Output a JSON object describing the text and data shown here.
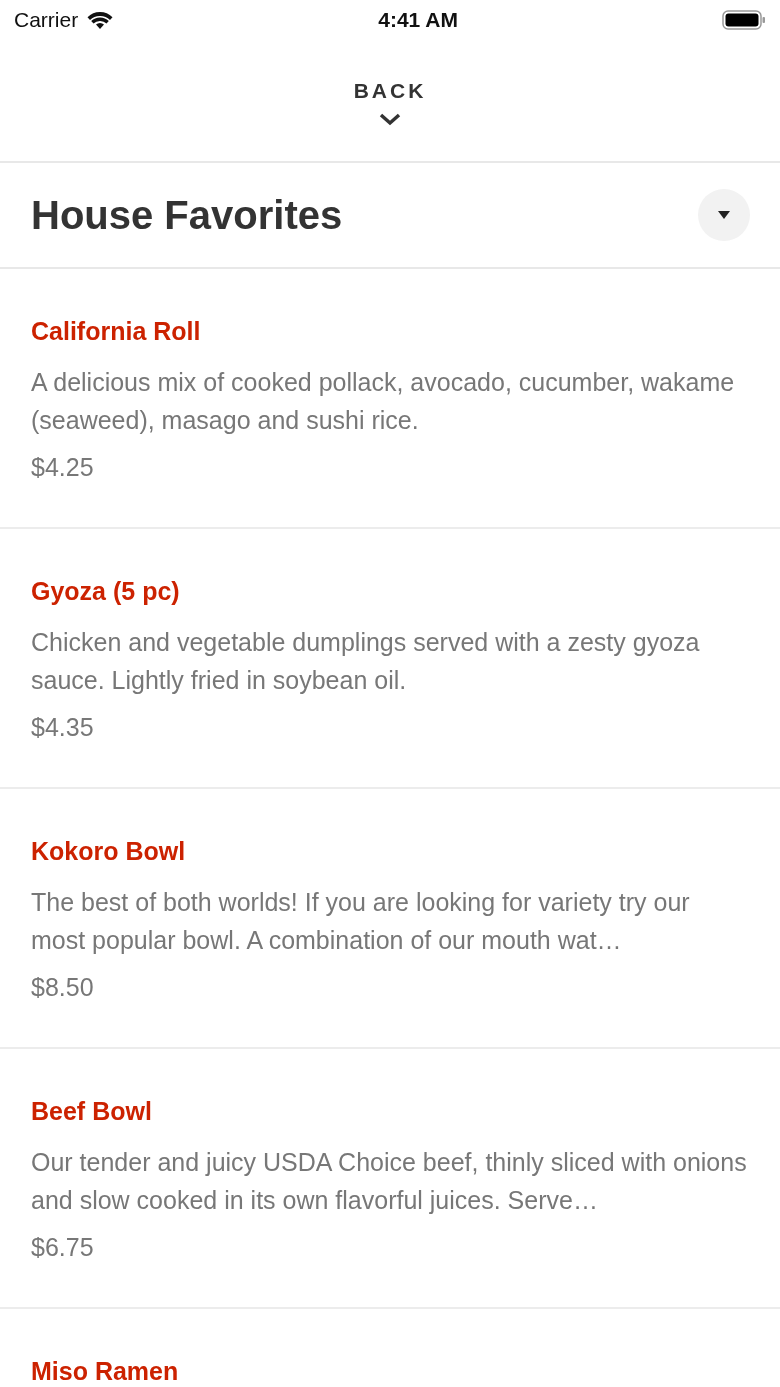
{
  "status_bar": {
    "carrier": "Carrier",
    "time": "4:41 AM"
  },
  "back": {
    "label": "BACK"
  },
  "section": {
    "title": "House Favorites",
    "expanded": true
  },
  "items": [
    {
      "name": "California Roll",
      "description": "A delicious mix of cooked pollack, avocado, cucumber, wakame (seaweed), masago and sushi rice.",
      "price": "$4.25"
    },
    {
      "name": "Gyoza (5 pc)",
      "description": "Chicken and vegetable dumplings served with a zesty gyoza sauce. Lightly fried in soybean oil.",
      "price": "$4.35"
    },
    {
      "name": "Kokoro Bowl",
      "description": "The best of both worlds! If you are looking for variety try our most popular bowl. A combination of our mouth wat…",
      "price": "$8.50"
    },
    {
      "name": "Beef Bowl",
      "description": "Our tender and juicy USDA Choice beef, thinly sliced with onions and slow cooked in its own flavorful juices. Serve…",
      "price": "$6.75"
    },
    {
      "name": "Miso Ramen"
    }
  ]
}
